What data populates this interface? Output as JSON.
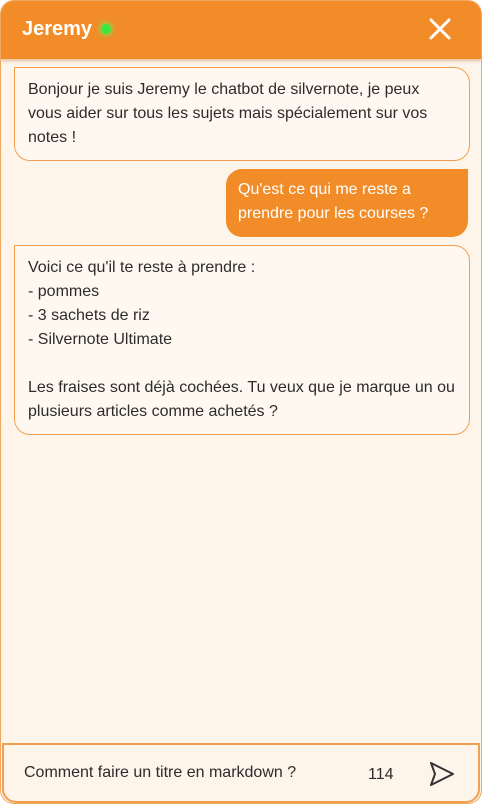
{
  "header": {
    "title": "Jeremy",
    "status": "online",
    "close_icon": "close-icon"
  },
  "colors": {
    "accent": "#f28c28",
    "background": "#fdf4ea",
    "online": "#3ee53e"
  },
  "messages": [
    {
      "sender": "bot",
      "text": "Bonjour je suis Jeremy le chatbot de silvernote, je peux vous aider sur tous les sujets mais spécialement sur vos notes !"
    },
    {
      "sender": "user",
      "text": "Qu'est ce qui me reste a prendre pour les courses ?"
    },
    {
      "sender": "bot",
      "text": "Voici ce qu'il te reste à prendre :\n- pommes\n- 3 sachets de riz\n- Silvernote Ultimate\n\nLes fraises sont déjà cochées. Tu veux que je marque un ou plusieurs articles comme achetés ?"
    }
  ],
  "composer": {
    "value": "Comment faire un titre en markdown ?",
    "char_count": "114",
    "send_icon": "send-icon"
  }
}
